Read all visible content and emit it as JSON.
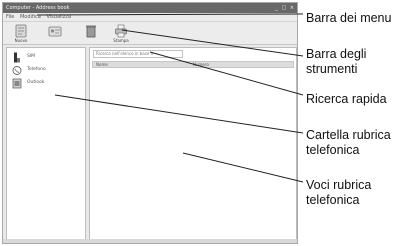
{
  "app": {
    "title": "Computer - Address book",
    "window_controls": "_ □ ×",
    "menu": [
      "File",
      "Modifica",
      "Visualizza"
    ],
    "toolbar": [
      {
        "label": "Nuovo",
        "icon": "new-contact-icon"
      },
      {
        "label": "",
        "icon": "contact-card-icon"
      },
      {
        "label": "",
        "icon": "delete-icon"
      },
      {
        "label": "Stampa",
        "icon": "print-icon"
      }
    ],
    "folders": [
      {
        "label": "SIM",
        "icon": "sim-card-icon"
      },
      {
        "label": "Telefono",
        "icon": "phone-icon"
      },
      {
        "label": "Outlook",
        "icon": "outlook-icon"
      }
    ],
    "quick_search_placeholder": "Ricerca nell'elenco in base a",
    "list_columns": [
      "Nome",
      "Numero"
    ]
  },
  "callouts": [
    {
      "label": "Barra dei menu"
    },
    {
      "label": "Barra degli\nstrumenti"
    },
    {
      "label": "Ricerca rapida"
    },
    {
      "label": "Cartella rubrica\ntelefonica"
    },
    {
      "label": "Voci rubrica\ntelefonica"
    }
  ]
}
